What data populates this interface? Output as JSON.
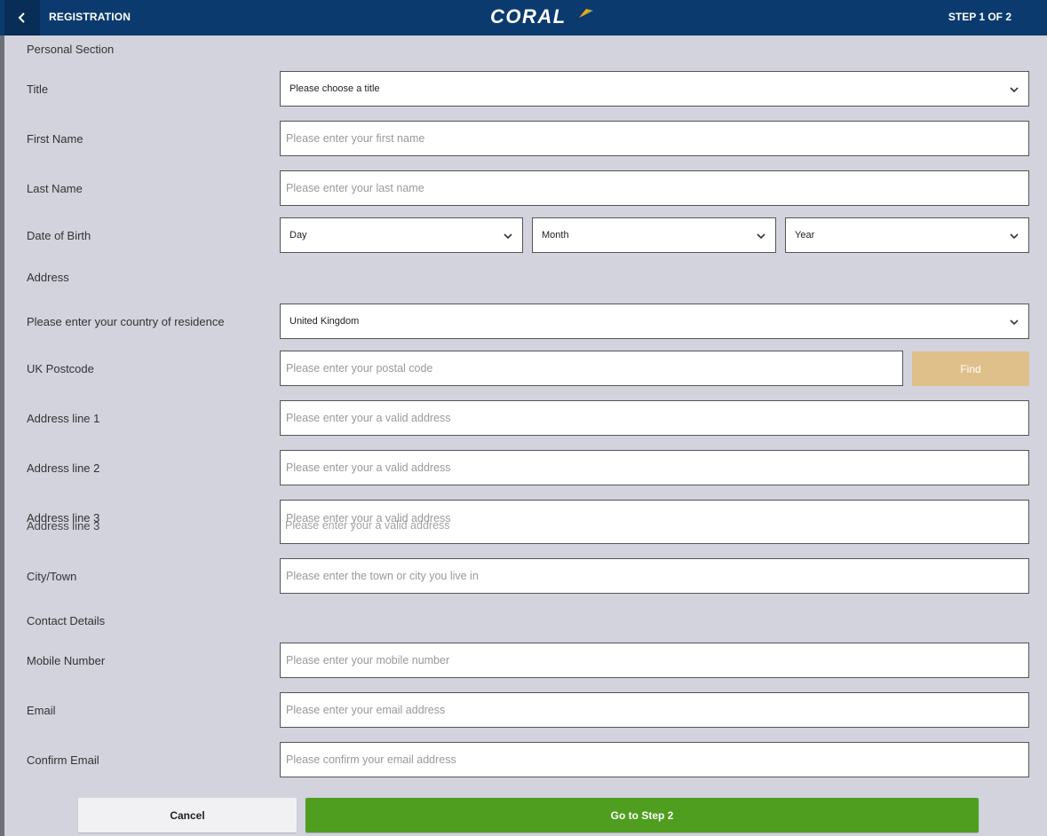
{
  "header": {
    "title": "REGISTRATION",
    "logo": "CORAL",
    "step": "STEP 1 OF 2",
    "bg_color": "#0b3a6e"
  },
  "sections": {
    "personal": "Personal Section",
    "address": "Address",
    "contact": "Contact Details"
  },
  "fields": {
    "title": {
      "label": "Title",
      "value": "Please choose a title"
    },
    "first_name": {
      "label": "First Name",
      "placeholder": "Please enter your first name"
    },
    "last_name": {
      "label": "Last Name",
      "placeholder": "Please enter your last name"
    },
    "dob": {
      "label": "Date of Birth",
      "day": "Day",
      "month": "Month",
      "year": "Year"
    },
    "country": {
      "label": "Please enter your country of residence",
      "value": "United Kingdom"
    },
    "postcode": {
      "label": "UK Postcode",
      "placeholder": "Please enter your postal code",
      "button": "Find"
    },
    "address1": {
      "label": "Address line 1",
      "placeholder": "Please enter your a valid address"
    },
    "address2": {
      "label": "Address line 2",
      "placeholder": "Please enter your a valid address"
    },
    "address3": {
      "label": "Address line 3",
      "placeholder": "Please enter your a valid address"
    },
    "city": {
      "label": "City/Town",
      "placeholder": "Please enter the town or city you live in"
    },
    "mobile": {
      "label": "Mobile Number",
      "placeholder": "Please enter your mobile number"
    },
    "email": {
      "label": "Email",
      "placeholder": "Please enter your email address"
    },
    "confirm_email": {
      "label": "Confirm Email",
      "placeholder": "Please confirm your email address"
    }
  },
  "actions": {
    "cancel": "Cancel",
    "next": "Go to Step 2"
  },
  "colors": {
    "find_button": "#dfc08a",
    "next_button": "#4f9e1f",
    "page_bg": "#d2d3dd"
  },
  "icons": {
    "back": "chevron-left-icon",
    "dropdown": "chevron-down-icon"
  }
}
